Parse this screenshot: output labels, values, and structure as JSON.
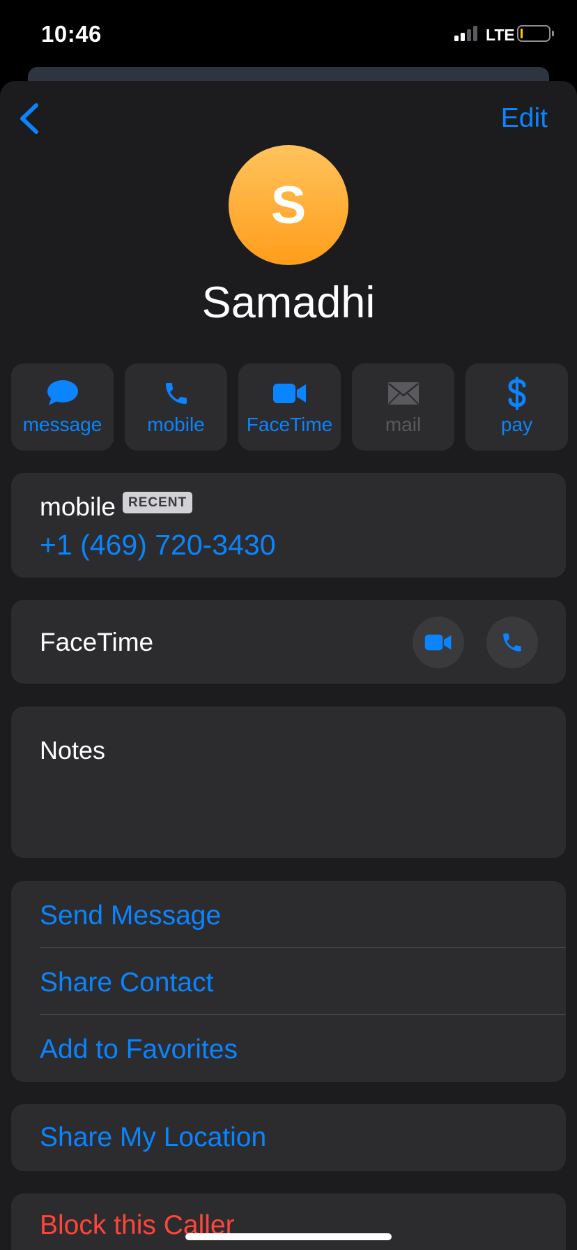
{
  "status_bar": {
    "time": "10:46",
    "network": "LTE"
  },
  "nav": {
    "edit_label": "Edit"
  },
  "contact": {
    "initial": "S",
    "name": "Samadhi"
  },
  "actions": [
    {
      "label": "message",
      "icon": "message-bubble-icon",
      "enabled": true
    },
    {
      "label": "mobile",
      "icon": "phone-icon",
      "enabled": true
    },
    {
      "label": "FaceTime",
      "icon": "video-camera-icon",
      "enabled": true
    },
    {
      "label": "mail",
      "icon": "envelope-icon",
      "enabled": false
    },
    {
      "label": "pay",
      "icon": "dollar-icon",
      "enabled": true
    }
  ],
  "phone": {
    "label": "mobile",
    "badge": "RECENT",
    "number": "+1 (469) 720-3430"
  },
  "facetime": {
    "label": "FaceTime"
  },
  "notes": {
    "label": "Notes"
  },
  "options": [
    "Send Message",
    "Share Contact",
    "Add to Favorites"
  ],
  "location": {
    "label": "Share My Location"
  },
  "block": {
    "label": "Block this Caller"
  },
  "colors": {
    "accent": "#0a84ff",
    "destructive": "#ff453a",
    "avatar_top": "#ffc35c",
    "avatar_bottom": "#ff9d1a"
  }
}
